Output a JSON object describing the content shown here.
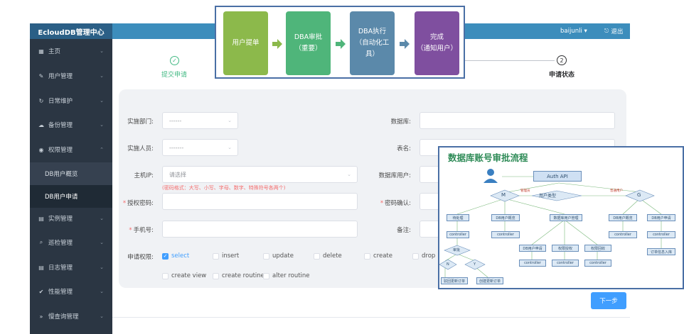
{
  "app": {
    "brand": "EcloudDB管理中心",
    "user": "baijunli ▾",
    "logout": "退出"
  },
  "sidebar": {
    "items": [
      {
        "label": "主页",
        "icon": "grid-icon",
        "glyph": "▦"
      },
      {
        "label": "用户管理",
        "icon": "pencil-icon",
        "glyph": "✎"
      },
      {
        "label": "日常维护",
        "icon": "refresh-icon",
        "glyph": "↻"
      },
      {
        "label": "备份管理",
        "icon": "cloud-icon",
        "glyph": "☁"
      },
      {
        "label": "权限管理",
        "icon": "eye-icon",
        "glyph": "◉"
      },
      {
        "label": "实例管理",
        "icon": "file-icon",
        "glyph": "▤"
      },
      {
        "label": "巡检管理",
        "icon": "search-icon",
        "glyph": "⌕"
      },
      {
        "label": "日志管理",
        "icon": "list-icon",
        "glyph": "▤"
      },
      {
        "label": "性能管理",
        "icon": "check-circle-icon",
        "glyph": "✔"
      },
      {
        "label": "慢查询管理",
        "icon": "double-chevron-icon",
        "glyph": "»"
      }
    ],
    "sub_items": [
      {
        "label": "DB用户概览"
      },
      {
        "label": "DB用户申请"
      }
    ],
    "chevron_down": "⌄",
    "chevron_up": "⌃"
  },
  "steps": {
    "step1": {
      "label": "提交申请",
      "mark": "✓"
    },
    "step2": {
      "label": "申请状态",
      "mark": "2"
    }
  },
  "form": {
    "dept_label": "实施部门:",
    "dept_value": "------",
    "db_label": "数据库:",
    "implementer_label": "实施人员:",
    "implementer_value": "-------",
    "table_label": "表名:",
    "host_label": "主机IP:",
    "host_placeholder": "请选择",
    "db_user_label": "数据库用户:",
    "password_hint": "(密码格式：大写、小写、字母、数字、特殊符号各两个)",
    "password_label": "授权密码:",
    "password_confirm_label": "密码确认:",
    "phone_label": "手机号:",
    "remark_label": "备注:",
    "perm_label": "申请权限:",
    "required_mark": "*",
    "permissions": [
      "select",
      "insert",
      "update",
      "delete",
      "create",
      "drop",
      "create view",
      "create routine",
      "alter routine"
    ],
    "checked_permission": "select",
    "next_button": "下一步"
  },
  "process_flow": {
    "steps": [
      {
        "lines": [
          "用户提单"
        ],
        "color": "#8cb94b"
      },
      {
        "lines": [
          "DBA审批",
          "（重要）"
        ],
        "color": "#4fb57a"
      },
      {
        "lines": [
          "DBA执行",
          "（自动化工",
          "具）"
        ],
        "color": "#5b89aa"
      },
      {
        "lines": [
          "完成",
          "（通知用户）"
        ],
        "color": "#7f4f9f"
      }
    ],
    "arrow_colors": [
      "#8cb94b",
      "#4fb57a",
      "#5b89aa"
    ]
  },
  "diagram": {
    "title": "数据库账号审批流程",
    "auth": "Auth API",
    "user_type": "用户类型",
    "m": "M",
    "g": "G",
    "manager_label": "管理员",
    "normal_label": "普通用户",
    "nodes_row1": [
      "待处理",
      "DB用户概览",
      "数据库用户管理",
      "DB用户概览",
      "DB用户申请"
    ],
    "controller": "controller",
    "approve": "审批",
    "n": "N",
    "y": "Y",
    "sub_nodes": [
      "DB用户申请",
      "权限授权",
      "权限回收"
    ],
    "end_nodes": [
      "驳回更新订单",
      "创建更新订单"
    ],
    "warehouse": "订单信息入库"
  }
}
